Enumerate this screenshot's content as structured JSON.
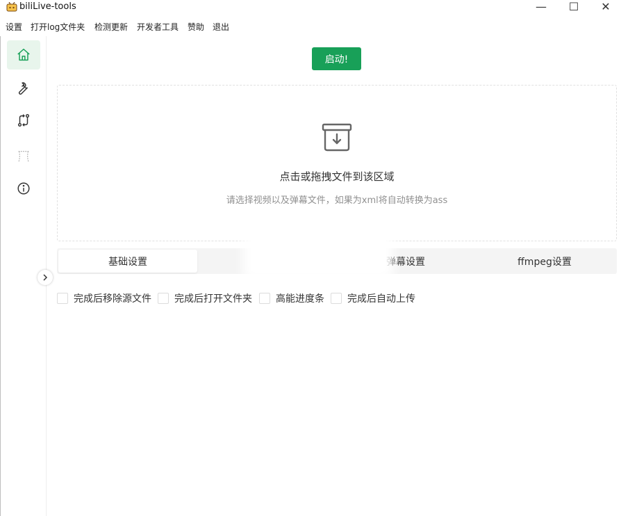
{
  "window": {
    "title": "biliLive-tools",
    "controls": {
      "minimize": "—",
      "maximize": "☐",
      "close": "✕"
    }
  },
  "menu": [
    "设置",
    "打开log文件夹",
    "检测更新",
    "开发者工具",
    "赞助",
    "退出"
  ],
  "sidebar": {
    "items": [
      {
        "name": "home",
        "icon": "home-icon",
        "active": true
      },
      {
        "name": "tools",
        "icon": "wrench-icon",
        "active": false
      },
      {
        "name": "convert",
        "icon": "git-compare-icon",
        "active": false
      },
      {
        "name": "danmaku",
        "icon": "curtain-icon",
        "active": false
      },
      {
        "name": "about",
        "icon": "info-icon",
        "active": false
      }
    ],
    "collapse_icon": "chevron-right-icon"
  },
  "main": {
    "start_button": "启动!",
    "dropzone": {
      "icon": "archive-download-icon",
      "title": "点击或拖拽文件到该区域",
      "hint": "请选择视频以及弹幕文件，如果为xml将自动转换为ass"
    },
    "tabs": [
      {
        "label": "基础设置",
        "active": true
      },
      {
        "label": "",
        "active": false
      },
      {
        "label": "弹幕设置",
        "active": false
      },
      {
        "label": "ffmpeg设置",
        "active": false
      }
    ],
    "options": [
      {
        "label": "完成后移除源文件",
        "checked": false
      },
      {
        "label": "完成后打开文件夹",
        "checked": false
      },
      {
        "label": "高能进度条",
        "checked": false
      },
      {
        "label": "完成后自动上传",
        "checked": false
      }
    ]
  },
  "colors": {
    "accent": "#18a058",
    "active_nav_bg": "#e8f5ec"
  }
}
